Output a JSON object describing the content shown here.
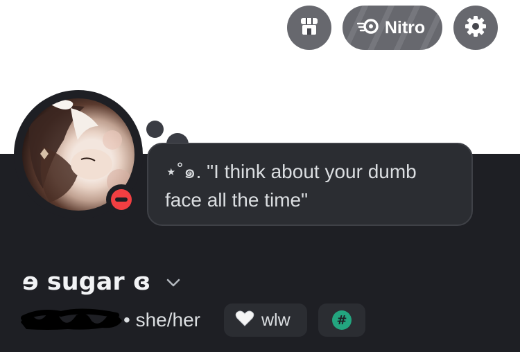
{
  "header": {
    "nitro_label": "Nitro"
  },
  "profile": {
    "status": "do-not-disturb",
    "custom_status": "⋆˚๑. \"I think about your dumb face all the time\"",
    "display_name": "ɘ sugar ɞ",
    "pronouns": "• she/her",
    "tags": [
      {
        "icon": "white-heart-icon",
        "label": "wlw"
      },
      {
        "icon": "hashtag-icon",
        "label": "#"
      }
    ]
  },
  "colors": {
    "panel_bg": "#1e1f24",
    "bubble_bg": "#2b2d32",
    "dnd_red": "#f23f42",
    "tag_green": "#23a57f",
    "button_bg": "#46474e"
  }
}
